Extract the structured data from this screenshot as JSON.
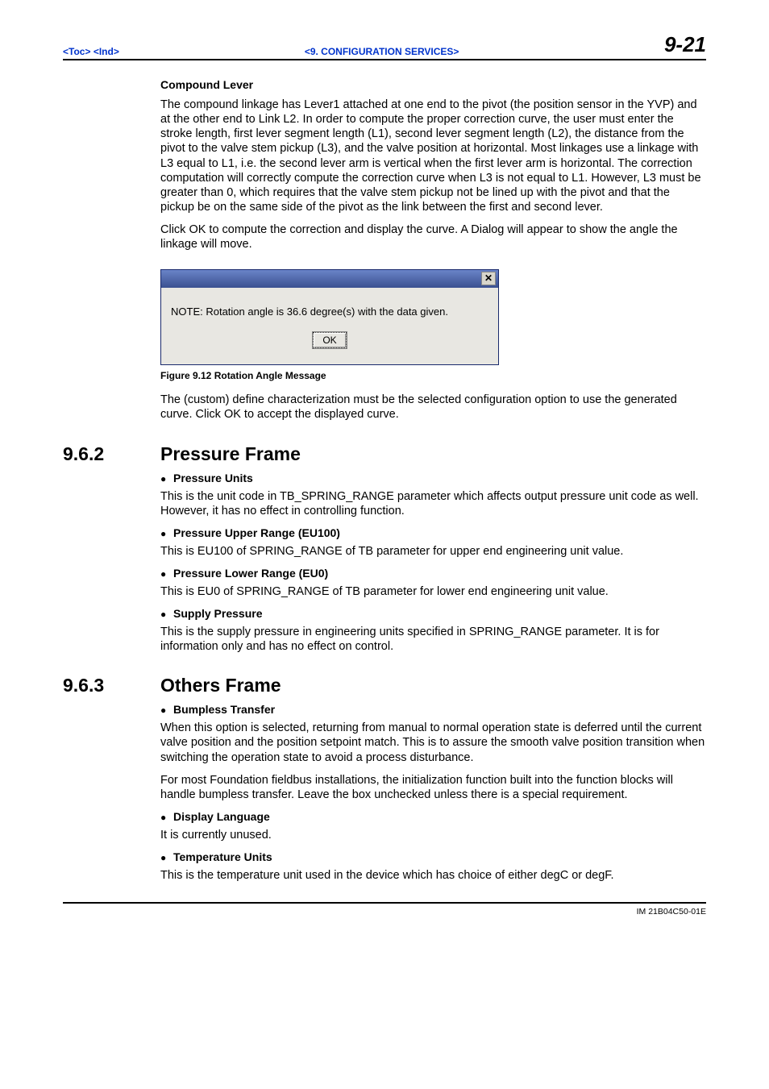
{
  "header": {
    "toc": "<Toc>",
    "ind": "<Ind>",
    "section": "<9.  CONFIGURATION SERVICES>",
    "page": "9-21"
  },
  "compound": {
    "title": "Compound Lever",
    "p1": "The compound linkage has Lever1 attached at one end to the pivot (the position sensor in the YVP) and at the other end to Link L2.  In order to compute the proper correction curve, the user must enter the stroke length, first lever segment length (L1), second lever segment length (L2), the distance from the pivot to the valve stem pickup (L3), and the valve position at horizontal.  Most linkages use a linkage with L3 equal to L1, i.e.  the second lever arm is vertical when the first lever arm is horizontal.  The correction computation will correctly compute the correction curve when L3 is not equal to L1.  However, L3 must be greater than 0, which requires that the valve stem pickup not be lined up with the pivot and that the pickup be on the same side of the pivot as the link between the first and second lever.",
    "p2": "Click OK to compute the correction and display the curve.  A Dialog will appear to show the angle the linkage will move."
  },
  "dialog": {
    "note": "NOTE:  Rotation angle is  36.6 degree(s) with the data given.",
    "ok": "OK",
    "close_icon": "✕"
  },
  "figure_caption": "Figure 9.12  Rotation Angle Message",
  "after_fig": "The (custom) define characterization must be the selected configuration option to use the generated curve.  Click OK to accept the displayed curve.",
  "sec962": {
    "num": "9.6.2",
    "title": "Pressure Frame",
    "items": [
      {
        "h": "Pressure Units",
        "p": "This is the unit code in TB_SPRING_RANGE parameter which affects output pressure unit code as well.  However, it has no effect in controlling function."
      },
      {
        "h": "Pressure Upper Range (EU100)",
        "p": "This is EU100 of SPRING_RANGE of TB parameter for upper end engineering unit value."
      },
      {
        "h": "Pressure Lower Range (EU0)",
        "p": "This is EU0 of SPRING_RANGE of TB parameter for lower end engineering unit value."
      },
      {
        "h": "Supply Pressure",
        "p": "This is the supply pressure in engineering units specified in SPRING_RANGE parameter. It is for information only and has no effect on control."
      }
    ]
  },
  "sec963": {
    "num": "9.6.3",
    "title": "Others Frame",
    "items": [
      {
        "h": "Bumpless Transfer",
        "p1": "When this option is selected, returning from manual to normal operation state is deferred until the current valve position and the position setpoint match.  This is to assure the smooth valve position transition when switching the operation state to avoid a process disturbance.",
        "p2": "For most Foundation fieldbus installations, the initialization function built into the function blocks will handle bumpless transfer.  Leave the box unchecked unless there is a special requirement."
      },
      {
        "h": "Display Language",
        "p1": "It is currently unused."
      },
      {
        "h": "Temperature Units",
        "p1": "This is the temperature unit used in the device which has choice of either degC or degF."
      }
    ]
  },
  "footer_id": "IM 21B04C50-01E"
}
